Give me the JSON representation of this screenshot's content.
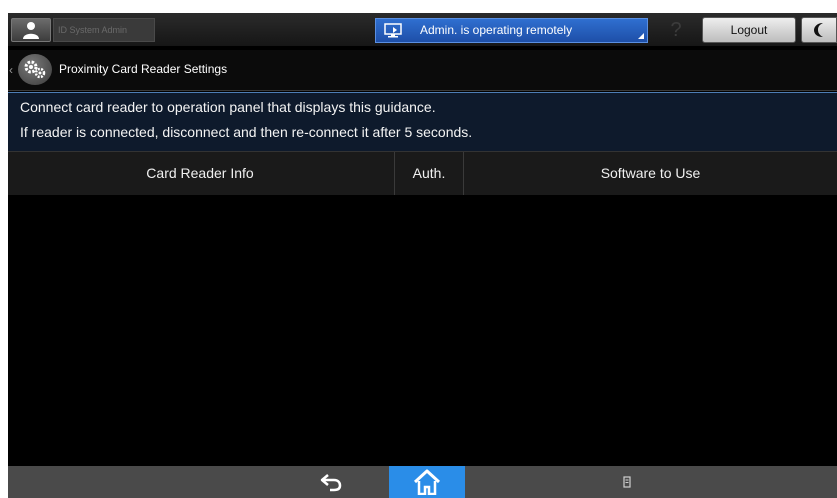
{
  "topbar": {
    "user_name": "ID System Admin",
    "remote_status": "Admin. is operating remotely",
    "help_symbol": "?",
    "logout_label": "Logout"
  },
  "titlebar": {
    "back_symbol": "‹",
    "title": "Proximity Card Reader Settings"
  },
  "guidance": {
    "line1": "Connect card reader to operation panel that displays this guidance.",
    "line2": "If reader is connected, disconnect and then re-connect it after 5 seconds."
  },
  "table": {
    "columns": [
      "Card Reader Info",
      "Auth.",
      "Software to Use"
    ],
    "rows": []
  },
  "bottombar": {
    "icons": [
      "back-arrow-icon",
      "home-icon",
      "menu-icon"
    ]
  },
  "colors": {
    "screen_bg": "#000000",
    "accent_blue": "#2a8de8",
    "remote_banner": "#2f6fd0",
    "guidance_bg": "#0e1a2c"
  }
}
